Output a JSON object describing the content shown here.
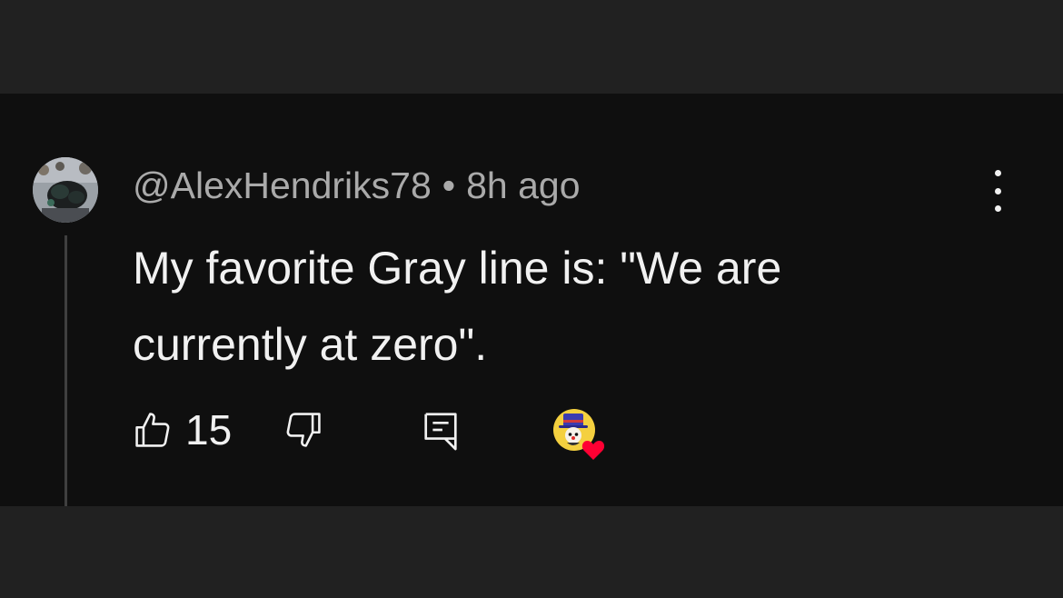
{
  "comment": {
    "author": "@AlexHendriks78",
    "separator": "•",
    "timestamp": "8h ago",
    "text": "My favorite Gray line is: \"We are currently at zero\".",
    "like_count": "15"
  },
  "icons": {
    "more": "more-vertical-icon",
    "like": "thumbs-up-icon",
    "dislike": "thumbs-down-icon",
    "reply": "reply-comment-icon",
    "heart": "creator-heart-icon"
  },
  "colors": {
    "card_background": "#0f0f0f",
    "page_background": "#212121",
    "text_primary": "#f1f1f1",
    "text_secondary": "#aaaaaa",
    "heart": "#ff0033"
  }
}
